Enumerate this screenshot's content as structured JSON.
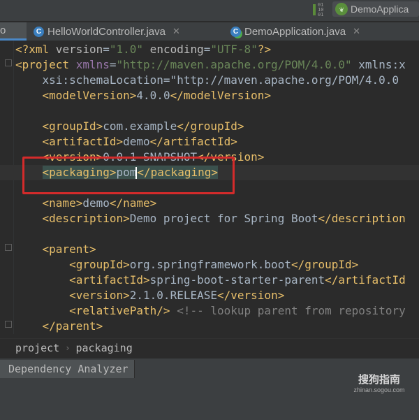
{
  "toolbar": {
    "run_config_label": "DemoApplica",
    "vcs_bits": [
      "01",
      "10",
      "01"
    ]
  },
  "tabs": [
    {
      "label": "o",
      "active": true
    },
    {
      "label": "HelloWorldController.java",
      "close": "✕"
    },
    {
      "label": "DemoApplication.java",
      "close": "✕"
    }
  ],
  "editor": {
    "lines": [
      "<?xml version=\"1.0\" encoding=\"UTF-8\"?>",
      "<project xmlns=\"http://maven.apache.org/POM/4.0.0\" xmlns:x",
      "    xsi:schemaLocation=\"http://maven.apache.org/POM/4.0.0",
      "    <modelVersion>4.0.0</modelVersion>",
      "",
      "    <groupId>com.example</groupId>",
      "    <artifactId>demo</artifactId>",
      "    <version>0.0.1-SNAPSHOT</version>",
      "    <packaging>pom</packaging>",
      "",
      "    <name>demo</name>",
      "    <description>Demo project for Spring Boot</description",
      "",
      "    <parent>",
      "        <groupId>org.springframework.boot</groupId>",
      "        <artifactId>spring-boot-starter-parent</artifactId",
      "        <version>2.1.0.RELEASE</version>",
      "        <relativePath/> <!-- lookup parent from repository",
      "    </parent>"
    ]
  },
  "breadcrumb": {
    "items": [
      "project",
      "packaging"
    ]
  },
  "bottom_panel": {
    "tab_label": "Dependency Analyzer"
  },
  "watermark": {
    "line1": "搜狗指南",
    "line2": "zhinan.sogou.com"
  }
}
